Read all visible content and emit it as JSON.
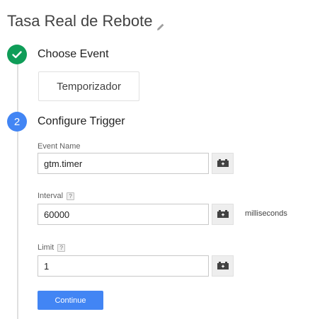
{
  "header": {
    "title": "Tasa Real de Rebote",
    "edit_icon": "pencil-icon"
  },
  "step1": {
    "status_icon": "check-icon",
    "title": "Choose Event",
    "event_value": "Temporizador"
  },
  "step2": {
    "number": "2",
    "title": "Configure Trigger",
    "fields": {
      "event_name": {
        "label": "Event Name",
        "value": "gtm.timer"
      },
      "interval": {
        "label": "Interval",
        "help": "?",
        "value": "60000",
        "suffix": "milliseconds"
      },
      "limit": {
        "label": "Limit",
        "help": "?",
        "value": "1"
      }
    },
    "variable_icon": "variable-picker-icon",
    "continue_label": "Continue"
  },
  "colors": {
    "success": "#0f9d58",
    "primary": "#4285f4"
  }
}
